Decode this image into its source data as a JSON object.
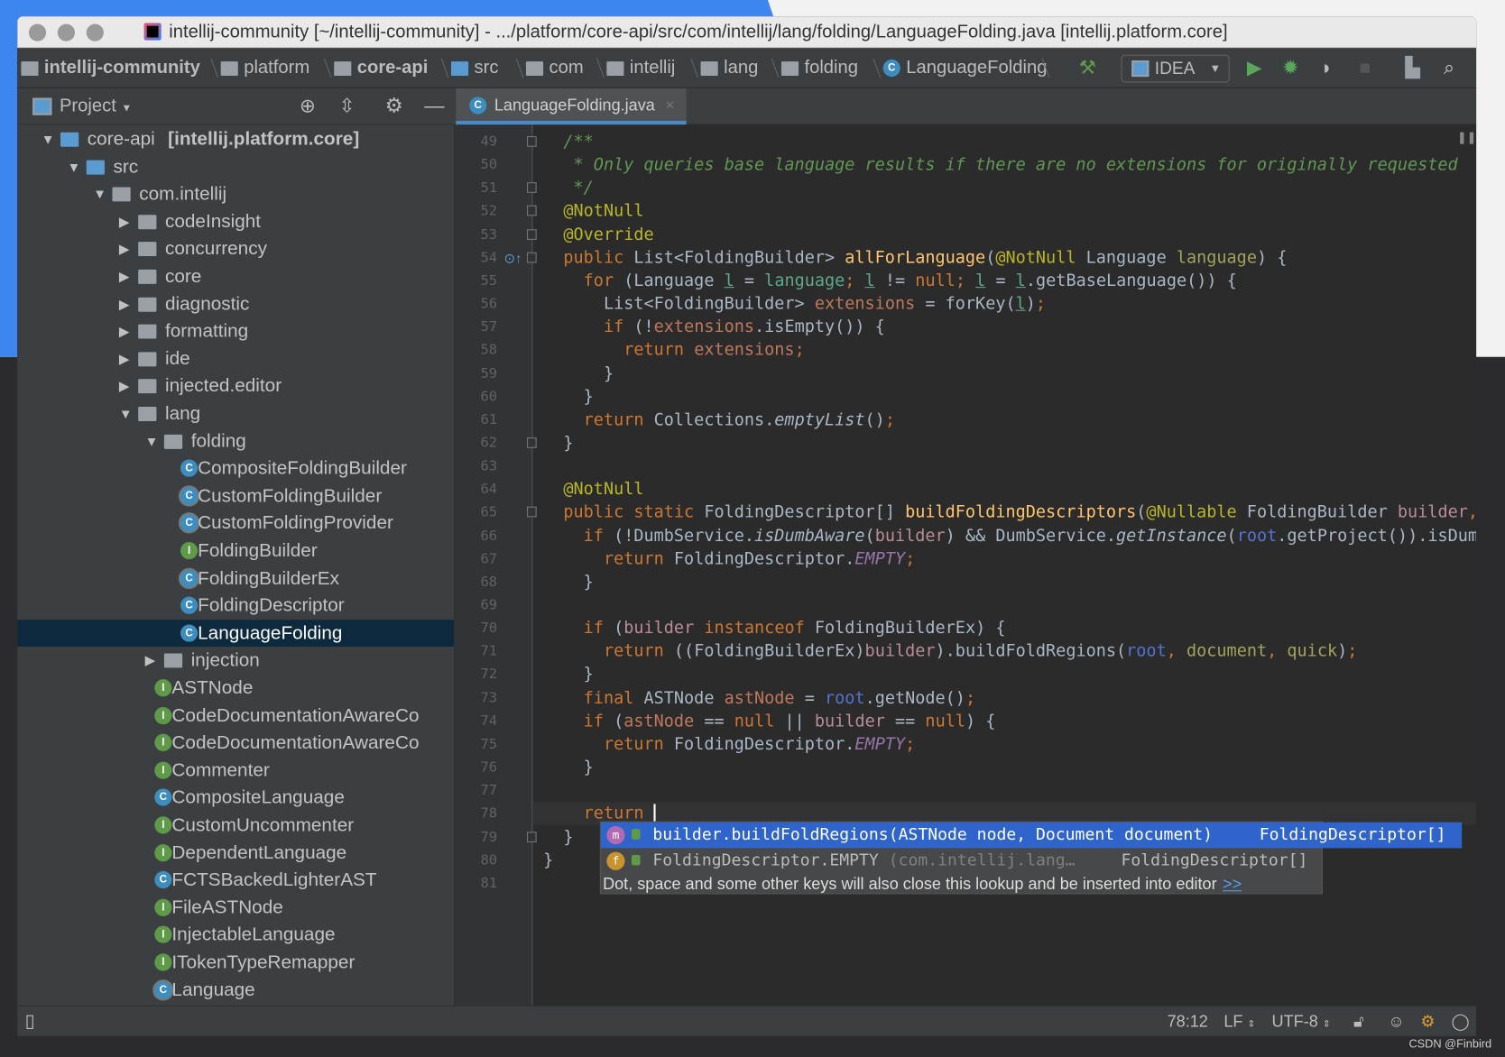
{
  "window": {
    "title": "intellij-community [~/intellij-community] - .../platform/core-api/src/com/intellij/lang/folding/LanguageFolding.java [intellij.platform.core]"
  },
  "breadcrumbs": [
    {
      "label": "intellij-community",
      "icon": "module-folder-icon",
      "bold": true
    },
    {
      "label": "platform",
      "icon": "folder-icon"
    },
    {
      "label": "core-api",
      "icon": "module-folder-icon",
      "bold": true
    },
    {
      "label": "src",
      "icon": "source-folder-icon"
    },
    {
      "label": "com",
      "icon": "package-icon"
    },
    {
      "label": "intellij",
      "icon": "package-icon"
    },
    {
      "label": "lang",
      "icon": "package-icon"
    },
    {
      "label": "folding",
      "icon": "package-icon"
    },
    {
      "label": "LanguageFolding",
      "icon": "class-icon"
    }
  ],
  "toolbar": {
    "run_config": "IDEA",
    "icons": [
      "build-hammer-icon",
      "run-icon",
      "debug-icon",
      "coverage-icon",
      "stop-icon",
      "project-structure-icon",
      "search-icon"
    ]
  },
  "project_panel": {
    "title": "Project",
    "icons": [
      "locate-icon",
      "collapse-all-icon",
      "gear-icon",
      "hide-icon"
    ]
  },
  "tab": {
    "label": "LanguageFolding.java",
    "icon": "class-icon"
  },
  "tree": [
    {
      "label": "core-api ",
      "suffix": "[intellij.platform.core]",
      "level": 0,
      "arrow": "down",
      "icon": "module"
    },
    {
      "label": "src",
      "level": 1,
      "arrow": "down",
      "icon": "srcfolder"
    },
    {
      "label": "com.intellij",
      "level": 2,
      "arrow": "down",
      "icon": "folder"
    },
    {
      "label": "codeInsight",
      "level": 3,
      "arrow": "right",
      "icon": "folder"
    },
    {
      "label": "concurrency",
      "level": 3,
      "arrow": "right",
      "icon": "folder"
    },
    {
      "label": "core",
      "level": 3,
      "arrow": "right",
      "icon": "folder"
    },
    {
      "label": "diagnostic",
      "level": 3,
      "arrow": "right",
      "icon": "folder"
    },
    {
      "label": "formatting",
      "level": 3,
      "arrow": "right",
      "icon": "folder"
    },
    {
      "label": "ide",
      "level": 3,
      "arrow": "right",
      "icon": "folder"
    },
    {
      "label": "injected.editor",
      "level": 3,
      "arrow": "right",
      "icon": "folder"
    },
    {
      "label": "lang",
      "level": 3,
      "arrow": "down",
      "icon": "folder"
    },
    {
      "label": "folding",
      "level": 4,
      "arrow": "down",
      "icon": "folder"
    },
    {
      "label": "CompositeFoldingBuilder",
      "level": 5,
      "icon": "class"
    },
    {
      "label": "CustomFoldingBuilder",
      "level": 5,
      "icon": "abstract"
    },
    {
      "label": "CustomFoldingProvider",
      "level": 5,
      "icon": "abstract"
    },
    {
      "label": "FoldingBuilder",
      "level": 5,
      "icon": "interface"
    },
    {
      "label": "FoldingBuilderEx",
      "level": 5,
      "icon": "abstract"
    },
    {
      "label": "FoldingDescriptor",
      "level": 5,
      "icon": "class"
    },
    {
      "label": "LanguageFolding",
      "level": 5,
      "icon": "class",
      "selected": true
    },
    {
      "label": "injection",
      "level": 4,
      "arrow": "right",
      "icon": "folder"
    },
    {
      "label": "ASTNode",
      "level": 4,
      "icon": "interface"
    },
    {
      "label": "CodeDocumentationAwareCo",
      "level": 4,
      "icon": "interface"
    },
    {
      "label": "CodeDocumentationAwareCo",
      "level": 4,
      "icon": "interface"
    },
    {
      "label": "Commenter",
      "level": 4,
      "icon": "interface"
    },
    {
      "label": "CompositeLanguage",
      "level": 4,
      "icon": "class"
    },
    {
      "label": "CustomUncommenter",
      "level": 4,
      "icon": "interface"
    },
    {
      "label": "DependentLanguage",
      "level": 4,
      "icon": "interface"
    },
    {
      "label": "FCTSBackedLighterAST",
      "level": 4,
      "icon": "class"
    },
    {
      "label": "FileASTNode",
      "level": 4,
      "icon": "interface"
    },
    {
      "label": "InjectableLanguage",
      "level": 4,
      "icon": "interface"
    },
    {
      "label": "ITokenTypeRemapper",
      "level": 4,
      "icon": "interface"
    },
    {
      "label": "Language",
      "level": 4,
      "icon": "abstract"
    }
  ],
  "code": {
    "first_line": 49,
    "current_line": 78,
    "lines": [
      [
        [
          "  /**",
          "cm"
        ]
      ],
      [
        [
          "   * Only queries base language results if there are no extensions for originally requested",
          "cm"
        ]
      ],
      [
        [
          "   */",
          "cm"
        ]
      ],
      [
        [
          "  @NotNull",
          "an"
        ]
      ],
      [
        [
          "  @Override",
          "an"
        ]
      ],
      [
        [
          "  public ",
          "kw"
        ],
        [
          "List<FoldingBuilder> ",
          ""
        ],
        [
          "allForLanguage",
          "fn"
        ],
        [
          "(",
          ""
        ],
        [
          "@NotNull",
          "an"
        ],
        [
          " Language ",
          ""
        ],
        [
          "language",
          "pv"
        ],
        [
          ") {",
          ""
        ]
      ],
      [
        [
          "    for ",
          "kw"
        ],
        [
          "(Language ",
          ""
        ],
        [
          "l",
          "lv ul"
        ],
        [
          " = ",
          ""
        ],
        [
          "language",
          "lv"
        ],
        [
          "; ",
          "kw"
        ],
        [
          "l",
          "lv ul"
        ],
        [
          " != ",
          ""
        ],
        [
          "null",
          "kw"
        ],
        [
          "; ",
          "kw"
        ],
        [
          "l",
          "lv ul"
        ],
        [
          " = ",
          ""
        ],
        [
          "l",
          "lv ul"
        ],
        [
          ".getBaseLanguage()) {",
          ""
        ]
      ],
      [
        [
          "      List<FoldingBuilder> ",
          ""
        ],
        [
          "extensions",
          "fld"
        ],
        [
          " = forKey(",
          ""
        ],
        [
          "l",
          "lv ul"
        ],
        [
          ")",
          ""
        ],
        [
          ";",
          "kw"
        ]
      ],
      [
        [
          "      if ",
          "kw"
        ],
        [
          "(!",
          ""
        ],
        [
          "extensions",
          "fld"
        ],
        [
          ".isEmpty()) {",
          ""
        ]
      ],
      [
        [
          "        return ",
          "kw"
        ],
        [
          "extensions",
          "fld"
        ],
        [
          ";",
          "kw"
        ]
      ],
      [
        [
          "      }",
          ""
        ]
      ],
      [
        [
          "    }",
          ""
        ]
      ],
      [
        [
          "    return ",
          "kw"
        ],
        [
          "Collections.",
          ""
        ],
        [
          "emptyList",
          "it"
        ],
        [
          "()",
          ""
        ],
        [
          ";",
          "kw"
        ]
      ],
      [
        [
          "  }",
          ""
        ]
      ],
      [
        [
          "",
          ""
        ]
      ],
      [
        [
          "  @NotNull",
          "an"
        ]
      ],
      [
        [
          "  public static ",
          "kw"
        ],
        [
          "FoldingDescriptor[] ",
          ""
        ],
        [
          "buildFoldingDescriptors",
          "fn"
        ],
        [
          "(",
          ""
        ],
        [
          "@Nullable",
          "an"
        ],
        [
          " FoldingBuilder ",
          ""
        ],
        [
          "builder",
          "bld"
        ],
        [
          ",",
          "kw"
        ]
      ],
      [
        [
          "    if ",
          "kw"
        ],
        [
          "(!DumbService.",
          ""
        ],
        [
          "isDumbAware",
          "it"
        ],
        [
          "(",
          ""
        ],
        [
          "builder",
          "bld"
        ],
        [
          ") && DumbService.",
          ""
        ],
        [
          "getInstance",
          "it"
        ],
        [
          "(",
          ""
        ],
        [
          "root",
          "rt"
        ],
        [
          ".getProject()).isDumb",
          ""
        ]
      ],
      [
        [
          "      return ",
          "kw"
        ],
        [
          "FoldingDescriptor.",
          ""
        ],
        [
          "EMPTY",
          "st"
        ],
        [
          ";",
          "kw"
        ]
      ],
      [
        [
          "    }",
          ""
        ]
      ],
      [
        [
          "",
          ""
        ]
      ],
      [
        [
          "    if ",
          "kw"
        ],
        [
          "(",
          ""
        ],
        [
          "builder",
          "bld"
        ],
        [
          " instanceof ",
          "kw"
        ],
        [
          "FoldingBuilderEx) {",
          ""
        ]
      ],
      [
        [
          "      return ",
          "kw"
        ],
        [
          "((FoldingBuilderEx)",
          ""
        ],
        [
          "builder",
          "bld"
        ],
        [
          ").buildFoldRegions(",
          ""
        ],
        [
          "root",
          "rt"
        ],
        [
          ", ",
          "kw"
        ],
        [
          "document",
          "pv"
        ],
        [
          ", ",
          "kw"
        ],
        [
          "quick",
          "pv"
        ],
        [
          ")",
          ""
        ],
        [
          ";",
          "kw"
        ]
      ],
      [
        [
          "    }",
          ""
        ]
      ],
      [
        [
          "    final ",
          "kw"
        ],
        [
          "ASTNode ",
          ""
        ],
        [
          "astNode",
          "fld"
        ],
        [
          " = ",
          ""
        ],
        [
          "root",
          "rt"
        ],
        [
          ".getNode()",
          ""
        ],
        [
          ";",
          "kw"
        ]
      ],
      [
        [
          "    if ",
          "kw"
        ],
        [
          "(",
          ""
        ],
        [
          "astNode",
          "fld"
        ],
        [
          " == ",
          ""
        ],
        [
          "null ",
          "kw"
        ],
        [
          "|| ",
          ""
        ],
        [
          "builder",
          "bld"
        ],
        [
          " == ",
          ""
        ],
        [
          "null",
          "kw"
        ],
        [
          ") {",
          ""
        ]
      ],
      [
        [
          "      return ",
          "kw"
        ],
        [
          "FoldingDescriptor.",
          ""
        ],
        [
          "EMPTY",
          "st"
        ],
        [
          ";",
          "kw"
        ]
      ],
      [
        [
          "    }",
          ""
        ]
      ],
      [
        [
          "",
          ""
        ]
      ],
      [
        [
          "    return ",
          "kw"
        ]
      ],
      [
        [
          "  }",
          ""
        ]
      ],
      [
        [
          "}",
          ""
        ]
      ],
      [
        [
          "",
          ""
        ]
      ]
    ]
  },
  "completion": {
    "items": [
      {
        "icon": "method-icon",
        "icon_letter": "m",
        "text": "builder.buildFoldRegions(ASTNode node, Document document)",
        "detail": "",
        "type": "FoldingDescriptor[]",
        "selected": true
      },
      {
        "icon": "field-icon",
        "icon_letter": "f",
        "text": "FoldingDescriptor.EMPTY",
        "detail": " (com.intellij.lang…",
        "type": "FoldingDescriptor[]"
      }
    ],
    "hint": "Dot, space and some other keys will also close this lookup and be inserted into editor",
    "hint_link": ">>"
  },
  "status": {
    "position": "78:12",
    "line_sep": "LF",
    "encoding": "UTF-8",
    "icons": [
      "toggle-tool-windows-icon",
      "lock-icon",
      "inspector-icon",
      "event-log-icon",
      "notifications-icon"
    ]
  },
  "watermark": "CSDN @Finbird",
  "colors": {
    "accent": "#2f65ca",
    "selection": "#0d293e",
    "keyword": "#cc7832",
    "annotation": "#bbb529",
    "method": "#ffc66d",
    "comment": "#629755"
  }
}
